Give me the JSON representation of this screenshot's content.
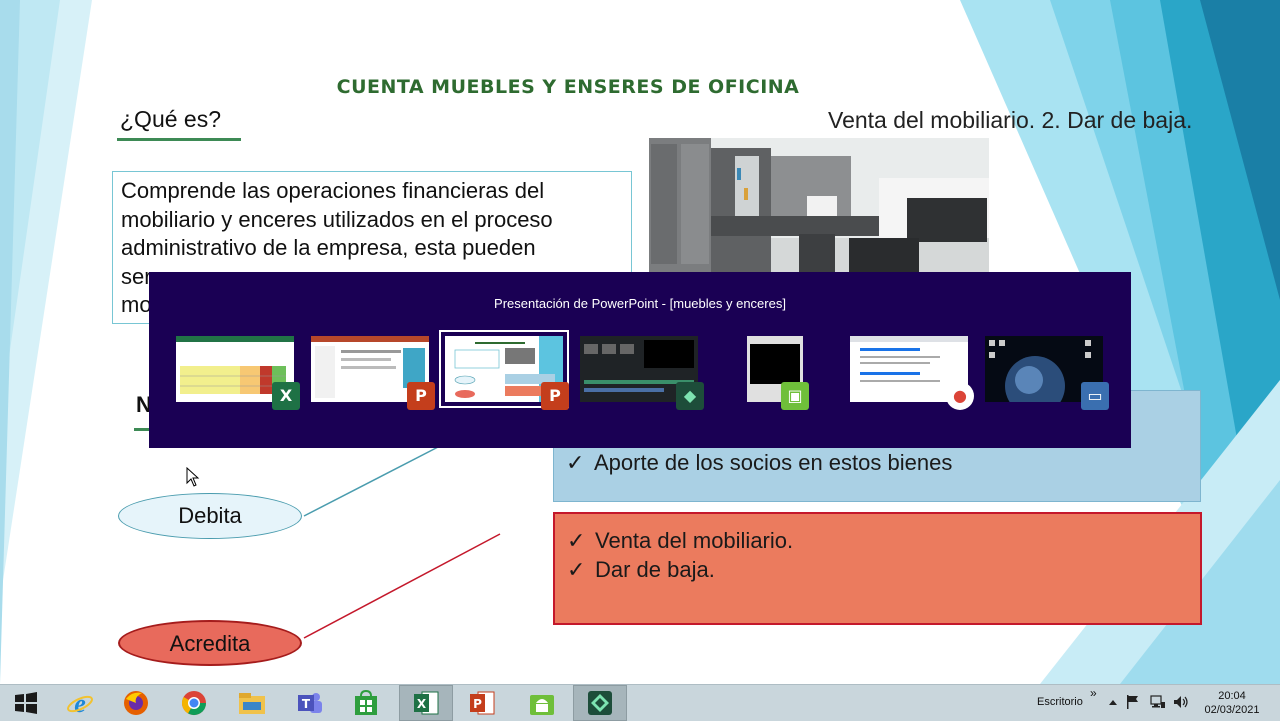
{
  "slide": {
    "title": "CUENTA MUEBLES Y ENSERES DE OFICINA",
    "question": "¿Qué es?",
    "top_right_text": "Venta del mobiliario. 2. Dar de baja.",
    "definition_lines": [
      "Comprende las operaciones financieras del",
      "mobiliario y enceres utilizados en el proceso",
      "administrativo de la empresa, esta pueden",
      "ser"
    ],
    "definition_last": "mo",
    "n_letter": "N",
    "debit_items": [
      "Aporte de los socios en estos bienes"
    ],
    "credit_items": [
      "Venta del mobiliario.",
      "Dar de baja."
    ],
    "check_symbol": "✓",
    "debit_label": "Debita",
    "credit_label": "Acredita"
  },
  "task_switcher": {
    "title": "Presentación de PowerPoint - [muebles y enceres]",
    "windows": [
      {
        "app": "excel-icon",
        "badge": "X",
        "color": "#1e7145",
        "selected": false
      },
      {
        "app": "powerpoint-icon",
        "badge": "P",
        "color": "#c43e1c",
        "selected": false
      },
      {
        "app": "powerpoint-icon",
        "badge": "P",
        "color": "#c43e1c",
        "selected": true
      },
      {
        "app": "filmora-icon",
        "badge": "◆",
        "color": "#1d4d3a",
        "selected": false
      },
      {
        "app": "android-emulator-icon",
        "badge": "▣",
        "color": "#6fbf3a",
        "selected": false
      },
      {
        "app": "chrome-icon",
        "badge": "●",
        "color": "#db4437",
        "selected": false
      },
      {
        "app": "desktop-icon",
        "badge": "▭",
        "color": "#3a6fb0",
        "selected": false
      }
    ]
  },
  "taskbar": {
    "desktop_label": "Escritorio",
    "chevron": "»",
    "time": "20:04",
    "date": "02/03/2021",
    "apps": [
      {
        "name": "windows-start-icon",
        "active": false
      },
      {
        "name": "internet-explorer-icon",
        "active": false
      },
      {
        "name": "firefox-icon",
        "active": false
      },
      {
        "name": "chrome-icon",
        "active": false
      },
      {
        "name": "file-explorer-icon",
        "active": false
      },
      {
        "name": "teams-icon",
        "active": false
      },
      {
        "name": "store-icon",
        "active": false
      },
      {
        "name": "excel-icon",
        "active": true
      },
      {
        "name": "powerpoint-icon",
        "active": false
      },
      {
        "name": "android-emulator-icon",
        "active": false
      },
      {
        "name": "filmora-icon",
        "active": true
      }
    ]
  }
}
